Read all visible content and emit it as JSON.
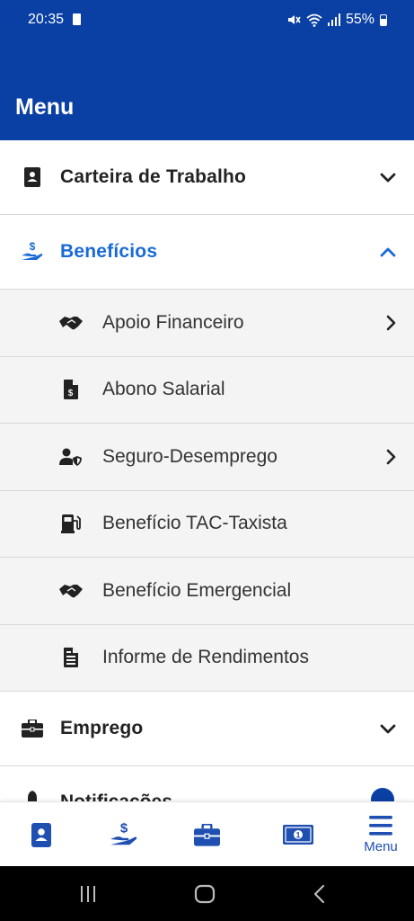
{
  "status_bar": {
    "time": "20:35",
    "battery": "55%",
    "icons": [
      "sim-icon",
      "mute-icon",
      "wifi-icon",
      "signal-icon",
      "battery-icon"
    ]
  },
  "app_bar": {
    "title": "Menu"
  },
  "menu": {
    "sections": [
      {
        "label": "Carteira de Trabalho",
        "icon": "id-card-icon",
        "expanded": false
      },
      {
        "label": "Benefícios",
        "icon": "hand-dollar-icon",
        "expanded": true,
        "items": [
          {
            "label": "Apoio Financeiro",
            "icon": "handshake-icon",
            "has_submenu": true
          },
          {
            "label": "Abono Salarial",
            "icon": "dollar-document-icon",
            "has_submenu": false
          },
          {
            "label": "Seguro-Desemprego",
            "icon": "user-shield-icon",
            "has_submenu": true
          },
          {
            "label": "Benefício TAC-Taxista",
            "icon": "gas-pump-icon",
            "has_submenu": false
          },
          {
            "label": "Benefício Emergencial",
            "icon": "handshake-icon",
            "has_submenu": false
          },
          {
            "label": "Informe de Rendimentos",
            "icon": "receipt-icon",
            "has_submenu": false
          }
        ]
      },
      {
        "label": "Emprego",
        "icon": "briefcase-icon",
        "expanded": false
      },
      {
        "label": "Notificações",
        "icon": "bell-icon",
        "partially_visible": true
      }
    ]
  },
  "bottom_nav": {
    "items": [
      {
        "icon": "id-card-icon",
        "label": ""
      },
      {
        "icon": "hand-dollar-icon",
        "label": ""
      },
      {
        "icon": "briefcase-icon",
        "label": ""
      },
      {
        "icon": "money-bill-icon",
        "label": ""
      },
      {
        "icon": "hamburger-menu-icon",
        "label": "Menu",
        "active": true
      }
    ]
  },
  "colors": {
    "primary": "#0a3fa3",
    "accent": "#1a6ad6",
    "submenu_bg": "#f4f4f4",
    "divider": "#d9d9d9"
  }
}
